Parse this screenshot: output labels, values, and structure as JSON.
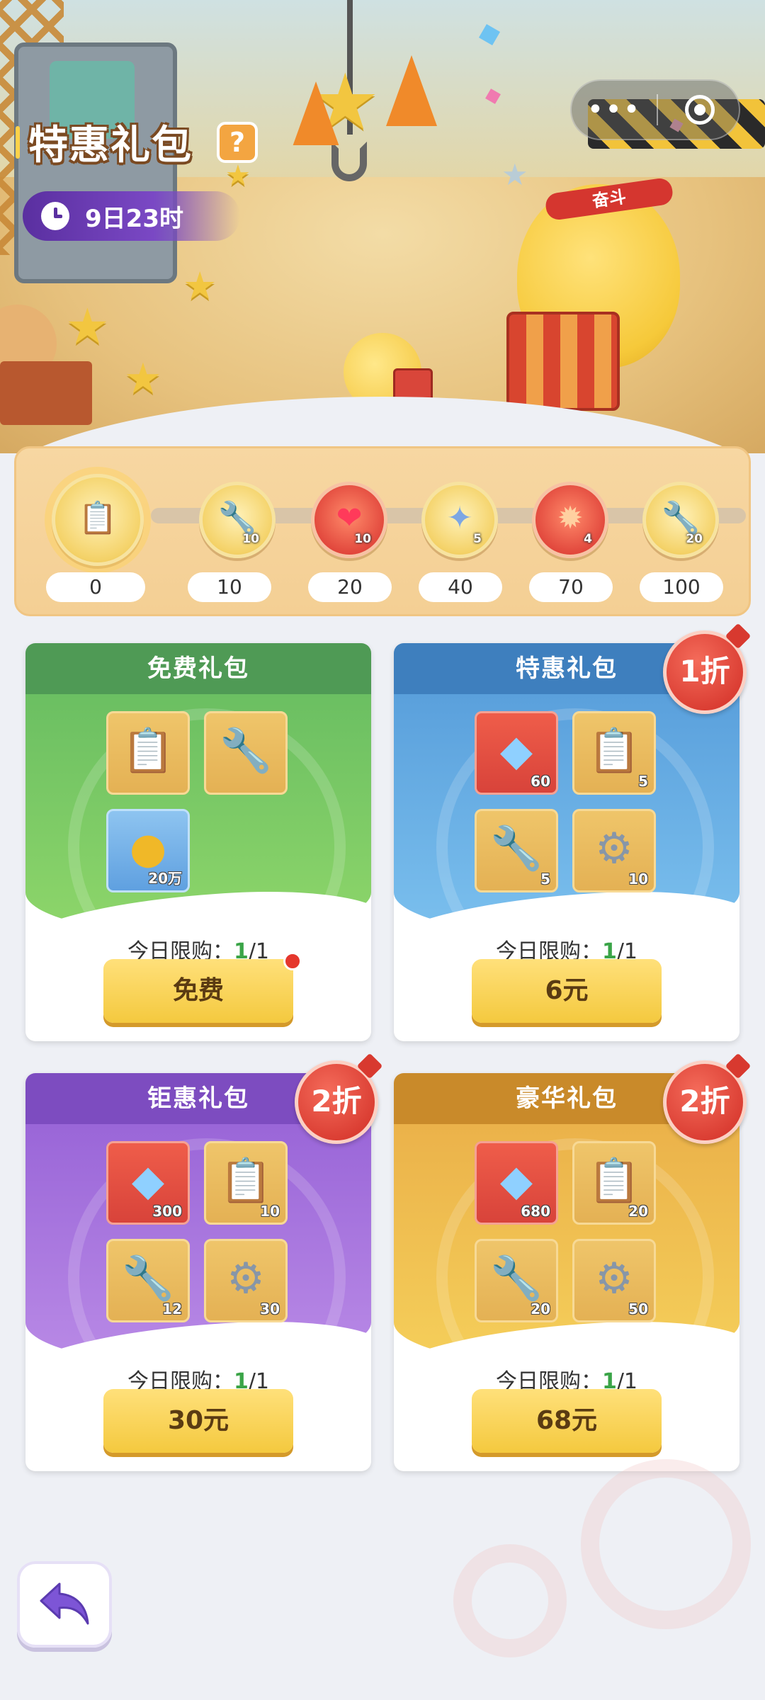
{
  "header": {
    "title": "特惠礼包",
    "help_icon": "question-icon",
    "help_label": "?",
    "timer": "9日23时",
    "timer_icon": "clock-icon",
    "headband_text": "奋斗",
    "menu_dots": "•••"
  },
  "progress": {
    "milestones": [
      {
        "value": "0",
        "icon": "clipboard-icon",
        "count": ""
      },
      {
        "value": "10",
        "icon": "wrench-icon",
        "count": "10"
      },
      {
        "value": "20",
        "icon": "heart-icon",
        "count": "10"
      },
      {
        "value": "40",
        "icon": "puzzle-icon",
        "count": "5"
      },
      {
        "value": "70",
        "icon": "fireball-icon",
        "count": "4"
      },
      {
        "value": "100",
        "icon": "wrench-icon",
        "count": "20"
      }
    ]
  },
  "packs": [
    {
      "title": "免费礼包",
      "theme": "#57a55a",
      "badge": "",
      "items": [
        {
          "icon": "clipboard-icon",
          "count": ""
        },
        {
          "icon": "wrench-icon",
          "count": ""
        },
        {
          "icon": "gold-coin-icon",
          "count": "20万"
        }
      ],
      "limit_label": "今日限购：",
      "limit_used": "1",
      "limit_total": "/1",
      "price": "免费"
    },
    {
      "title": "特惠礼包",
      "theme": "#4f8fc9",
      "badge": "1折",
      "items": [
        {
          "icon": "diamond-icon",
          "count": "60"
        },
        {
          "icon": "clipboard-icon",
          "count": "5"
        },
        {
          "icon": "wrench-icon",
          "count": "5"
        },
        {
          "icon": "gear-icon",
          "count": "10"
        }
      ],
      "limit_label": "今日限购：",
      "limit_used": "1",
      "limit_total": "/1",
      "price": "6元"
    },
    {
      "title": "钜惠礼包",
      "theme": "#8a56c8",
      "badge": "2折",
      "items": [
        {
          "icon": "diamond-icon",
          "count": "300"
        },
        {
          "icon": "clipboard-icon",
          "count": "10"
        },
        {
          "icon": "wrench-icon",
          "count": "12"
        },
        {
          "icon": "gear-icon",
          "count": "30"
        }
      ],
      "limit_label": "今日限购：",
      "limit_used": "1",
      "limit_total": "/1",
      "price": "30元"
    },
    {
      "title": "豪华礼包",
      "theme": "#d49230",
      "badge": "2折",
      "items": [
        {
          "icon": "diamond-icon",
          "count": "680"
        },
        {
          "icon": "clipboard-icon",
          "count": "20"
        },
        {
          "icon": "wrench-icon",
          "count": "20"
        },
        {
          "icon": "gear-icon",
          "count": "50"
        }
      ],
      "limit_label": "今日限购：",
      "limit_used": "1",
      "limit_total": "/1",
      "price": "68元"
    }
  ],
  "footer": {
    "back_icon": "back-arrow-icon"
  }
}
